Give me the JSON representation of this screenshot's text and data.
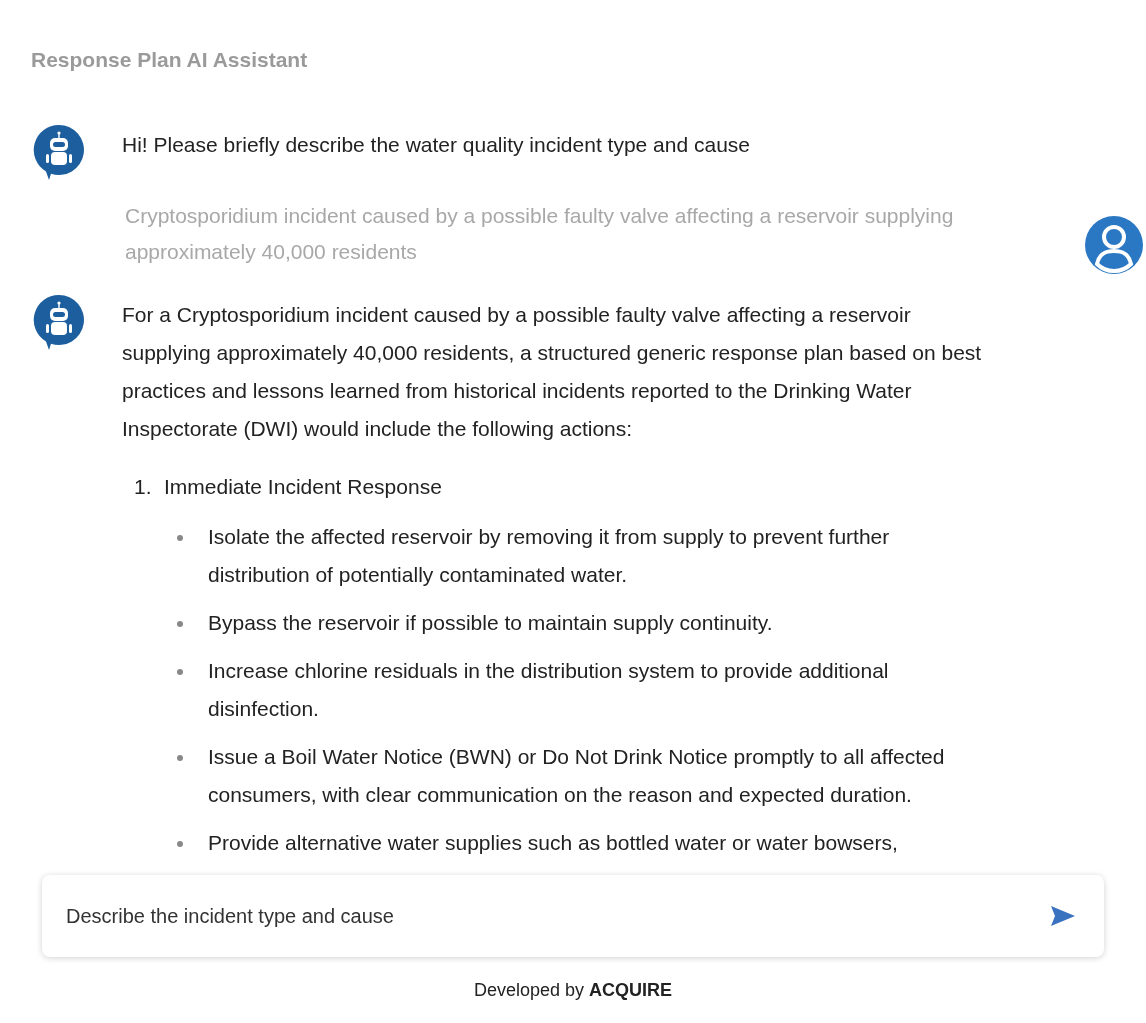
{
  "title": "Response Plan AI Assistant",
  "messages": [
    {
      "kind": "bot",
      "paragraphs": [
        "Hi! Please briefly describe the water quality incident type and cause"
      ]
    },
    {
      "kind": "user",
      "paragraphs": [
        "Cryptosporidium incident caused by a possible faulty valve affecting a reservoir supplying approximately 40,000 residents"
      ]
    },
    {
      "kind": "bot",
      "paragraphs": [
        "For a Cryptosporidium incident caused by a possible faulty valve affecting a reservoir supplying approximately 40,000 residents, a structured generic response plan based on best practices and lessons learned from historical incidents reported to the Drinking Water Inspectorate (DWI) would include the following actions:"
      ],
      "steps": [
        {
          "number": "1.",
          "title": "Immediate Incident Response",
          "bullets": [
            "Isolate the affected reservoir by removing it from supply to prevent further distribution of potentially contaminated water.",
            "Bypass the reservoir if possible to maintain supply continuity.",
            "Increase chlorine residuals in the distribution system to provide additional disinfection.",
            "Issue a Boil Water Notice (BWN) or Do Not Drink Notice promptly to all affected consumers, with clear communication on the reason and expected duration.",
            "Provide alternative water supplies such as bottled water or water bowsers,"
          ]
        }
      ]
    }
  ],
  "input": {
    "placeholder": "Describe the incident type and cause"
  },
  "footer": "Developed by **ACQUIRE**"
}
